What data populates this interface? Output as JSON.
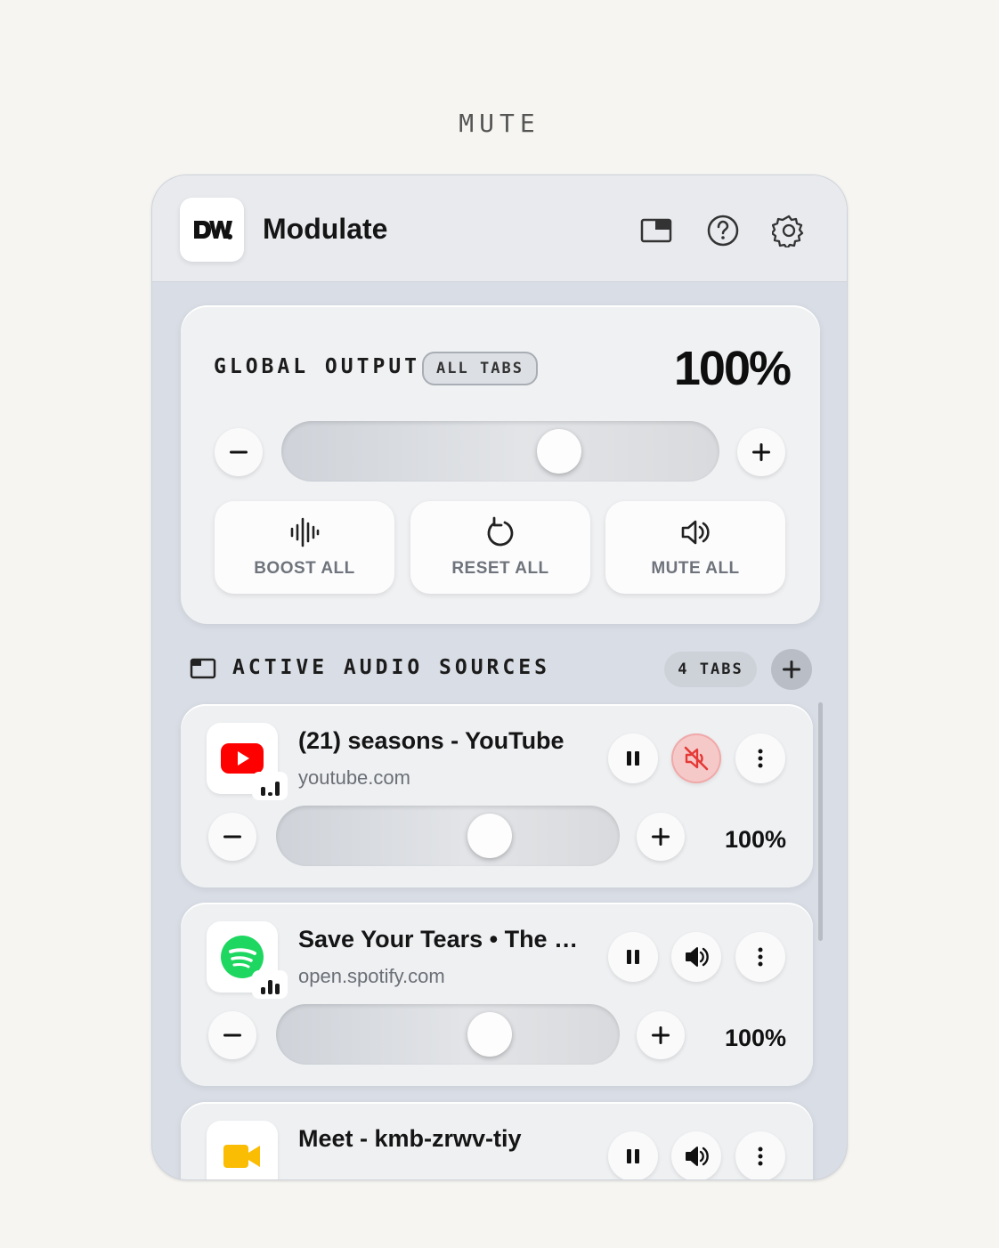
{
  "caption": "MUTE",
  "header": {
    "title": "Modulate",
    "icons": [
      "picture-in-picture-icon",
      "help-icon",
      "gear-icon"
    ]
  },
  "global": {
    "label": "GLOBAL OUTPUT",
    "scope_badge": "ALL TABS",
    "value": "100%",
    "slider_level": 0.65,
    "actions": [
      {
        "label": "BOOST ALL",
        "icon": "waveform-icon"
      },
      {
        "label": "RESET ALL",
        "icon": "reset-icon"
      },
      {
        "label": "MUTE ALL",
        "icon": "speaker-icon"
      }
    ]
  },
  "sources_header": {
    "title": "ACTIVE AUDIO SOURCES",
    "count_badge": "4 TABS"
  },
  "sources": [
    {
      "title": "(21) seasons - YouTube",
      "domain": "youtube.com",
      "value": "100%",
      "muted": true,
      "icon": "youtube-icon",
      "slider_level": 0.64
    },
    {
      "title": "Save Your Tears • The Weeknd",
      "domain": "open.spotify.com",
      "value": "100%",
      "muted": false,
      "icon": "spotify-icon",
      "slider_level": 0.64
    },
    {
      "title": "Meet - kmb-zrwv-tiy",
      "domain": "",
      "value": "",
      "muted": false,
      "icon": "meet-icon"
    }
  ],
  "colors": {
    "muted_bg": "#f6c9c9",
    "muted_icon": "#e53935",
    "youtube": "#ff0000",
    "spotify": "#1ed760",
    "meet": "#fbbc04"
  }
}
